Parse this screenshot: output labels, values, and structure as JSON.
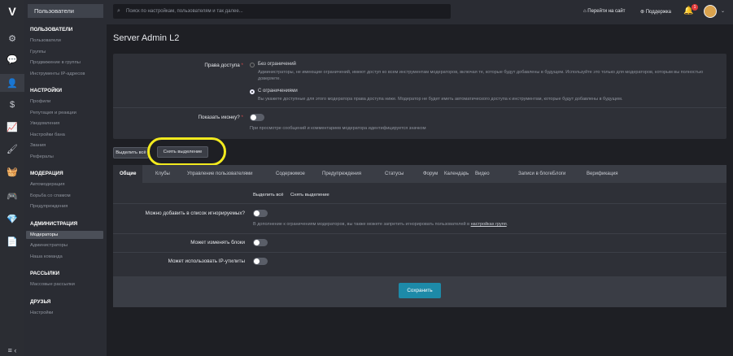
{
  "sidebar": {
    "title": "Пользователи",
    "sections": [
      {
        "title": "ПОЛЬЗОВАТЕЛИ",
        "items": [
          "Пользователи",
          "Группы",
          "Продвижение в группы",
          "Инструменты IP-адресов"
        ]
      },
      {
        "title": "НАСТРОЙКИ",
        "items": [
          "Профили",
          "Репутация и реакции",
          "Уведомления",
          "Настройки бана",
          "Звания",
          "Рефералы"
        ]
      },
      {
        "title": "МОДЕРАЦИЯ",
        "items": [
          "Автомодерация",
          "Борьба со спамом",
          "Предупреждения"
        ]
      },
      {
        "title": "АДМИНИСТРАЦИЯ",
        "items": [
          "Модераторы",
          "Администраторы",
          "Наша команда"
        ]
      },
      {
        "title": "РАССЫЛКИ",
        "items": [
          "Массовые рассылки"
        ]
      },
      {
        "title": "ДРУЗЬЯ",
        "items": [
          "Настройки"
        ]
      }
    ],
    "footer_icon": "≡ ‹"
  },
  "iconbar": {
    "logo": "V",
    "icons": [
      "gears-icon",
      "chat-icon",
      "user-icon",
      "dollar-icon",
      "chart-icon",
      "brush-icon",
      "basket-icon",
      "gamepad-icon",
      "diamond-icon",
      "document-icon"
    ],
    "glyphs": [
      "⚙",
      "💬",
      "👤",
      "$",
      "📈",
      "🖌",
      "🧺",
      "🎮",
      "💎",
      "📄"
    ]
  },
  "topbar": {
    "search_placeholder": "Поиск по настройкам, пользователям и так далее...",
    "goto_site": "Перейти на сайт",
    "support": "Поддержка",
    "notif_count": "1"
  },
  "page": {
    "title": "Server Admin L2"
  },
  "access": {
    "label": "Права доступа",
    "opt1_title": "Без ограничений",
    "opt1_desc": "Администраторы, не имеющие ограничений, имеют доступ ко всем инструментам модераторов, включая те, которые будут добавлены в будущем. Используйте это только для модераторов, которым вы полностью доверяете.",
    "opt2_title": "С ограничениями",
    "opt2_desc": "Вы укажете доступные для этого модератора права доступа ниже. Модератор не будет иметь автоматического доступа к инструментам, которые будут добавлены в будущем."
  },
  "icon_row": {
    "label": "Показать иконку?",
    "desc": "При просмотре сообщений и комментариев модератора идентифицируется значком"
  },
  "buttons": {
    "select_all": "Выделить всё",
    "deselect": "Снять выделение"
  },
  "tabs": [
    "Общие",
    "Клубы",
    "Управление пользователями",
    "Содержимое",
    "Предупреждения",
    "Статусы",
    "Форум",
    "Календарь",
    "Видео",
    "Записи в блоге",
    "Блоги",
    "Верификация"
  ],
  "general": {
    "select_all": "Выделить всё",
    "deselect": "Снять выделение",
    "ignore_label": "Можно добавить в список игнорируемых?",
    "ignore_desc": "В дополнение к ограничениям модераторов, вы также можете запретить игнорировать пользователей в ",
    "ignore_link": "настройках групп",
    "ignore_end": ".",
    "blocks_label": "Может изменять блоки",
    "ip_label": "Может использовать IP-утилиты"
  },
  "save": "Сохранить"
}
